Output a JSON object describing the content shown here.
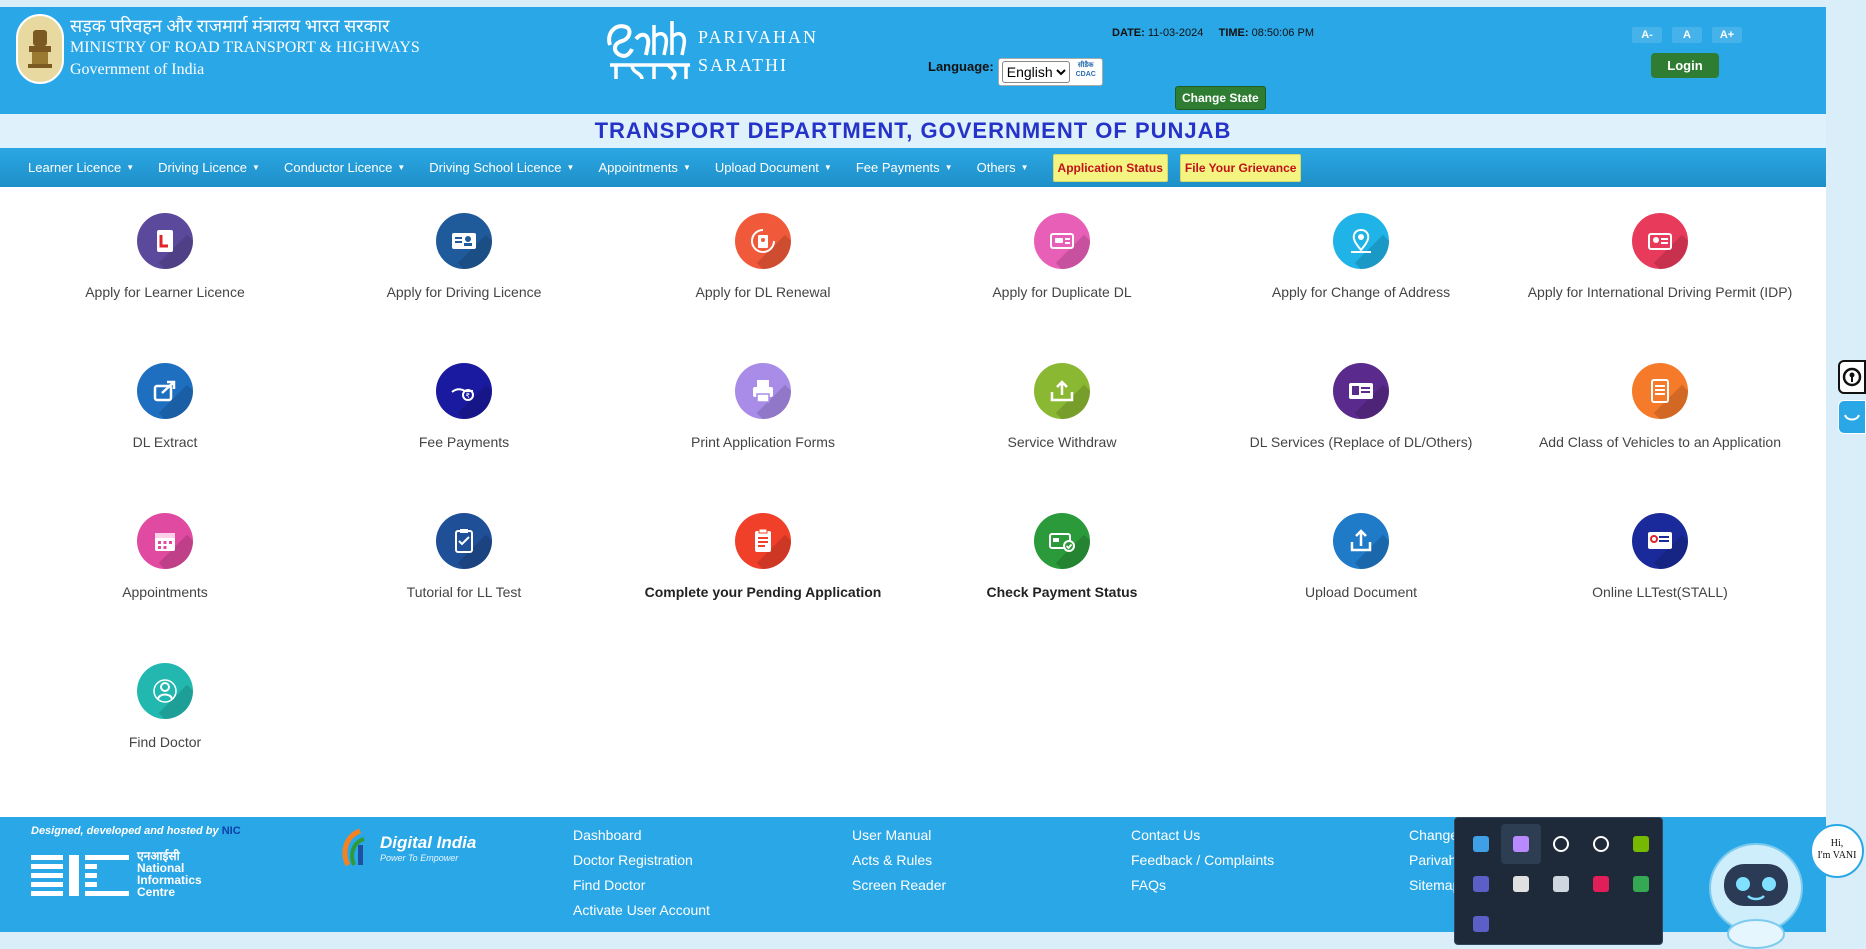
{
  "header": {
    "ministry_hindi": "सड़क परिवहन और राजमार्ग मंत्रालय भारत सरकार",
    "ministry_english": "MINISTRY OF ROAD TRANSPORT & HIGHWAYS",
    "government": "Government of India",
    "app_name_line1": "PARIVAHAN",
    "app_name_line2": "SARATHI",
    "date_label": "DATE:",
    "date_value": "11-03-2024",
    "time_label": "TIME:",
    "time_value": "08:50:06 PM",
    "language_label": "Language:",
    "language_value": "English",
    "cdac_label": "सीडैक CDAC",
    "change_state": "Change State",
    "font_decrease": "A-",
    "font_normal": "A",
    "font_increase": "A+",
    "login": "Login"
  },
  "department": "TRANSPORT DEPARTMENT, GOVERNMENT OF PUNJAB",
  "nav": {
    "items": [
      {
        "label": "Learner Licence"
      },
      {
        "label": "Driving Licence"
      },
      {
        "label": "Conductor Licence"
      },
      {
        "label": "Driving School Licence"
      },
      {
        "label": "Appointments"
      },
      {
        "label": "Upload Document"
      },
      {
        "label": "Fee Payments"
      },
      {
        "label": "Others"
      }
    ],
    "application_status": "Application Status",
    "grievance": "File Your Grievance"
  },
  "services": [
    {
      "label": "Apply for Learner Licence",
      "icon": "learner-licence-icon",
      "color": "#5b4a9c"
    },
    {
      "label": "Apply for Driving Licence",
      "icon": "driving-licence-icon",
      "color": "#1f5b9a"
    },
    {
      "label": "Apply for DL Renewal",
      "icon": "dl-renewal-icon",
      "color": "#f05a3a"
    },
    {
      "label": "Apply for Duplicate DL",
      "icon": "duplicate-dl-icon",
      "color": "#e85fb8"
    },
    {
      "label": "Apply for Change of Address",
      "icon": "map-pin-icon",
      "color": "#1fb3e8"
    },
    {
      "label": "Apply for International Driving Permit (IDP)",
      "icon": "idp-card-icon",
      "color": "#e83a5a"
    },
    {
      "label": "DL Extract",
      "icon": "share-icon",
      "color": "#1f6fc0"
    },
    {
      "label": "Fee Payments",
      "icon": "fee-payment-icon",
      "color": "#1a1aa0"
    },
    {
      "label": "Print Application Forms",
      "icon": "printer-icon",
      "color": "#a98be8"
    },
    {
      "label": "Service Withdraw",
      "icon": "upload-tray-icon",
      "color": "#8bb832"
    },
    {
      "label": "DL Services (Replace of DL/Others)",
      "icon": "id-card-icon",
      "color": "#5a2a8c"
    },
    {
      "label": "Add Class of Vehicles to an Application",
      "icon": "form-list-icon",
      "color": "#f57a2a"
    },
    {
      "label": "Appointments",
      "icon": "calendar-icon",
      "color": "#e04aa0"
    },
    {
      "label": "Tutorial for LL Test",
      "icon": "clipboard-check-icon",
      "color": "#1f4f96"
    },
    {
      "label": "Complete your Pending Application",
      "icon": "pending-form-icon",
      "color": "#f0402a",
      "bold": true
    },
    {
      "label": "Check Payment Status",
      "icon": "payment-status-icon",
      "color": "#2a9a3a",
      "bold": true
    },
    {
      "label": "Upload Document",
      "icon": "upload-icon",
      "color": "#1f7ac8"
    },
    {
      "label": "Online LLTest(STALL)",
      "icon": "online-test-icon",
      "color": "#1a2a9a"
    },
    {
      "label": "Find Doctor",
      "icon": "doctor-icon",
      "color": "#22b8b0"
    }
  ],
  "footer": {
    "credit": "Designed, developed and hosted by",
    "credit_link": "NIC",
    "nic_hindi": "एनआईसी",
    "nic_line1": "National",
    "nic_line2": "Informatics",
    "nic_line3": "Centre",
    "digital_india": "Digital India",
    "digital_india_tag": "Power To Empower",
    "col1": [
      "Dashboard",
      "Doctor Registration",
      "Find Doctor",
      "Activate User Account"
    ],
    "col2": [
      "User Manual",
      "Acts & Rules",
      "Screen Reader"
    ],
    "col3": [
      "Contact Us",
      "Feedback / Complaints",
      "FAQs"
    ],
    "col4": [
      "Change",
      "Parivah",
      "Sitemap"
    ]
  },
  "chatbot": {
    "greeting_line1": "Hi,",
    "greeting_line2": "I'm VANI"
  },
  "tray_icons": [
    "defender-warning-icon",
    "feather-icon",
    "location-icon",
    "epic-games-icon",
    "nvidia-icon",
    "teams-icon",
    "obs-icon",
    "settings-app-icon",
    "slack-icon",
    "chrome-icon",
    "teams-alt-icon"
  ]
}
